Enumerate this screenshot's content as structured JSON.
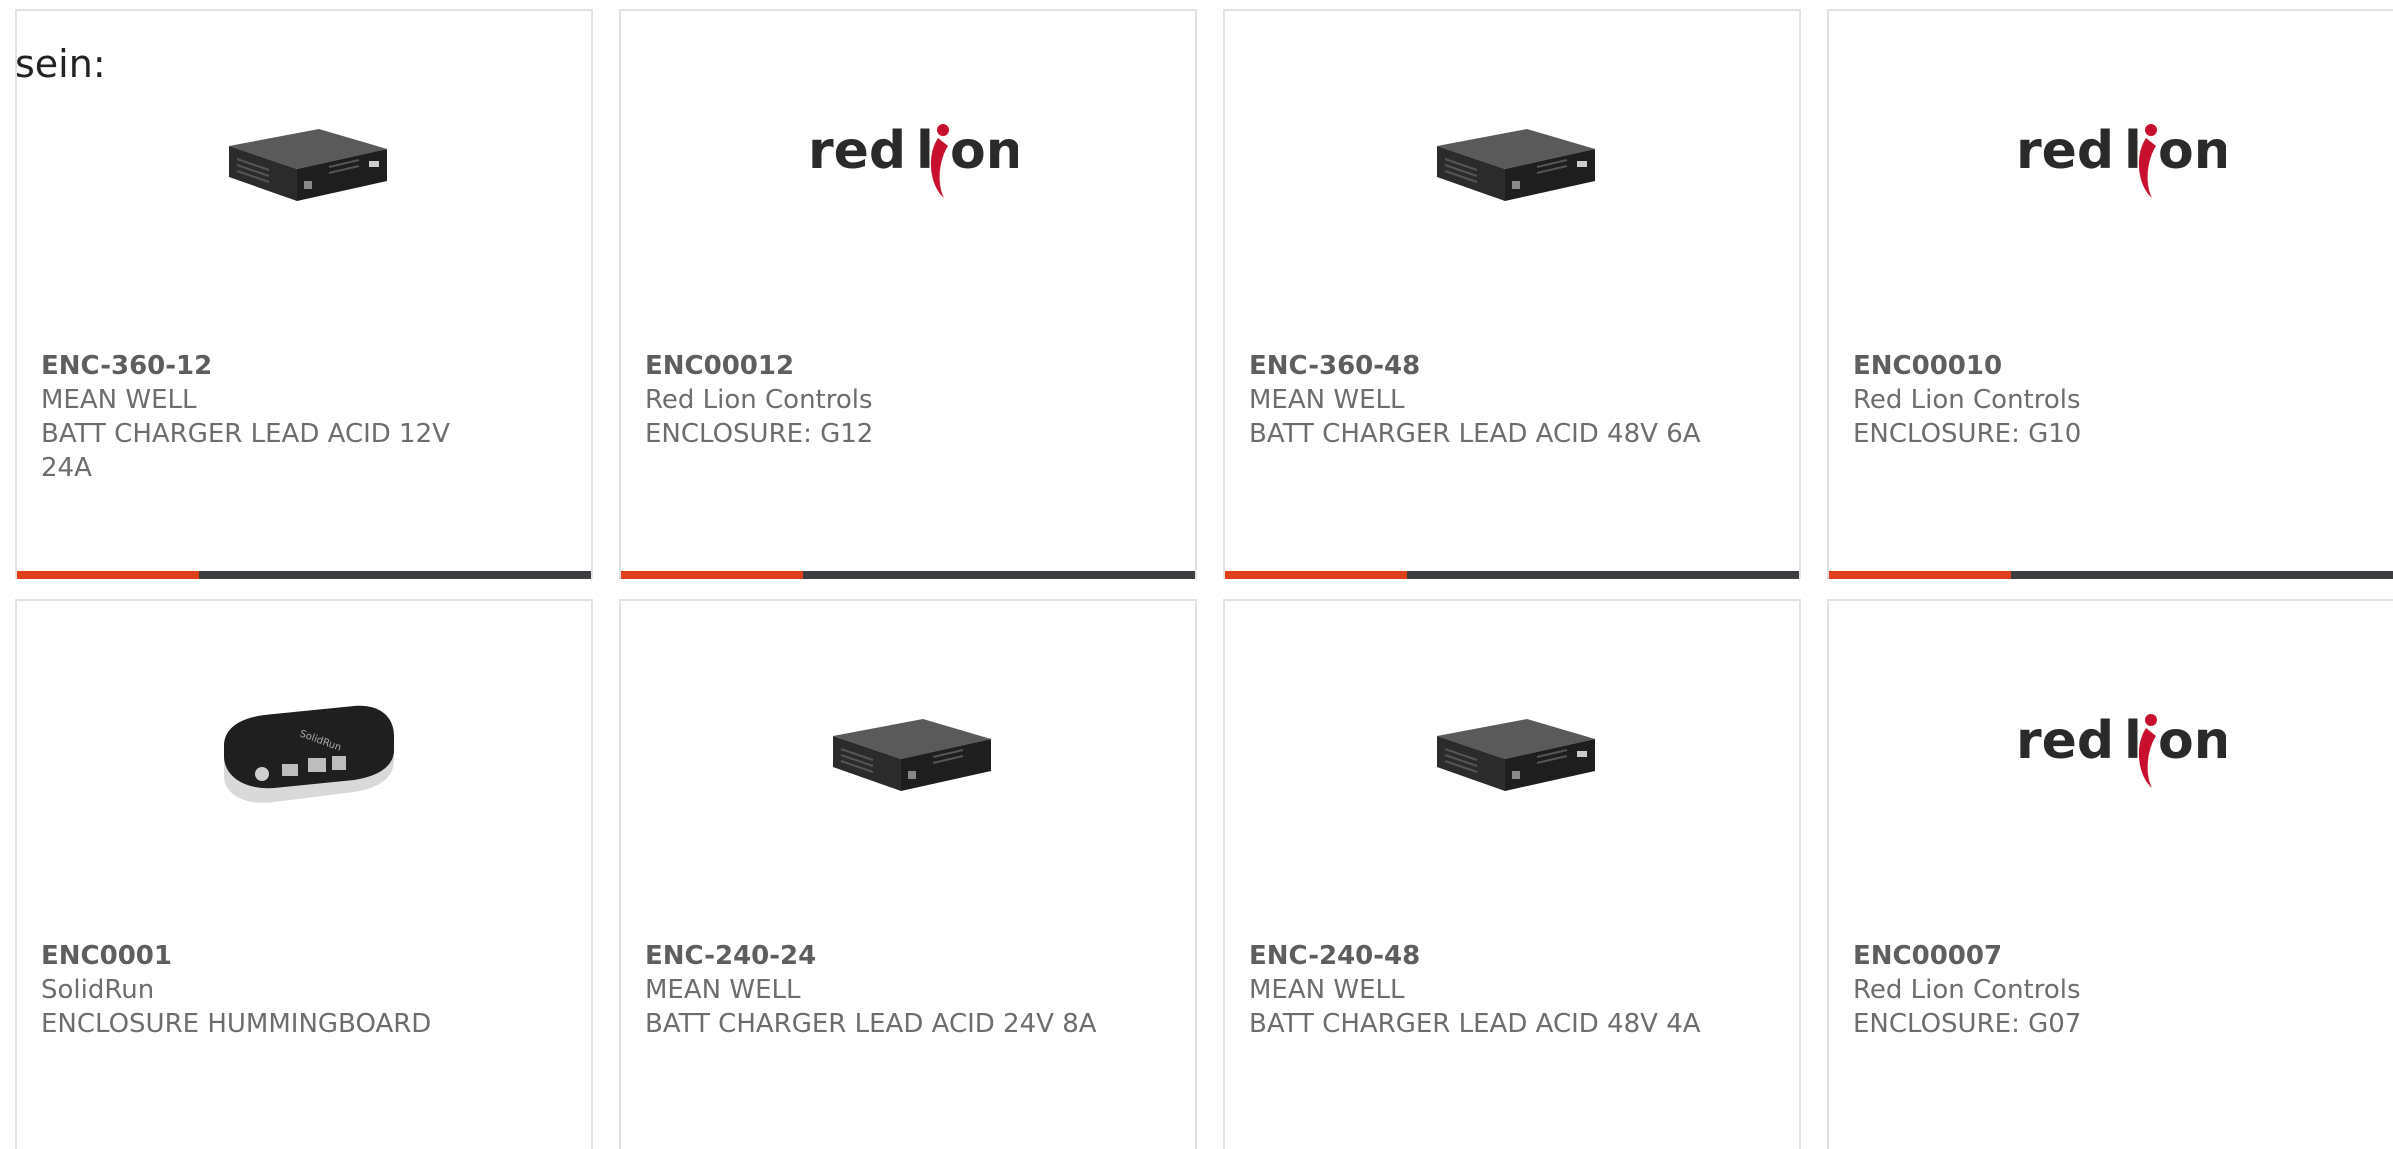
{
  "intro_text": "sein:",
  "accent_color": "#e0401a",
  "bar_color": "#3b3d40",
  "cards": [
    {
      "part": "ENC-360-12",
      "manufacturer": "MEAN WELL",
      "description": "BATT CHARGER LEAD ACID 12V 24A",
      "image": "charger-box"
    },
    {
      "part": "ENC00012",
      "manufacturer": "Red Lion Controls",
      "description": "ENCLOSURE: G12",
      "image": "red-lion-logo",
      "logo_text": "red lion"
    },
    {
      "part": "ENC-360-48",
      "manufacturer": "MEAN WELL",
      "description": "BATT CHARGER LEAD ACID 48V 6A",
      "image": "charger-box"
    },
    {
      "part": "ENC00010",
      "manufacturer": "Red Lion Controls",
      "description": "ENCLOSURE: G10",
      "image": "red-lion-logo",
      "logo_text": "red lion"
    },
    {
      "part": "ENC0001",
      "manufacturer": "SolidRun",
      "description": "ENCLOSURE HUMMINGBOARD",
      "image": "hummingboard-case"
    },
    {
      "part": "ENC-240-24",
      "manufacturer": "MEAN WELL",
      "description": "BATT CHARGER LEAD ACID 24V 8A",
      "image": "charger-box"
    },
    {
      "part": "ENC-240-48",
      "manufacturer": "MEAN WELL",
      "description": "BATT CHARGER LEAD ACID 48V 4A",
      "image": "charger-box"
    },
    {
      "part": "ENC00007",
      "manufacturer": "Red Lion Controls",
      "description": "ENCLOSURE: G07",
      "image": "red-lion-logo",
      "logo_text": "red lion"
    }
  ]
}
